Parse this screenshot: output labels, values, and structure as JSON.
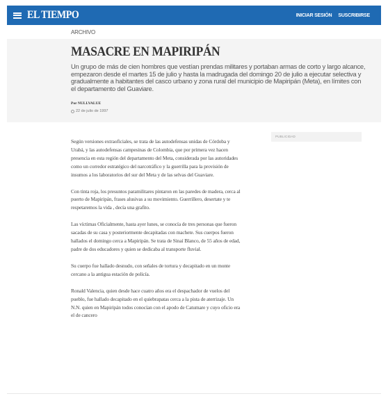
{
  "header": {
    "logo_text": "EL TIEMPO",
    "signin_label": "INICIAR SESIÓN",
    "subscribe_label": "SUSCRIBIRSE",
    "menu_icon": "hamburger-menu-icon",
    "brand_color": "#1f6ab3"
  },
  "section": {
    "label": "ARCHIVO"
  },
  "article": {
    "title": "MASACRE EN MAPIRIPÁN",
    "lead": "Un grupo de más de cien hombres que vestían prendas militares y portaban armas de corto y largo alcance, empezaron desde el martes 15 de julio y hasta la madrugada del domingo 20 de julio a ejecutar selectiva y gradualmente a habitantes del casco urbano y zona rural del municipio de Mapiripán (Meta), en límites con el departamento del Guaviare.",
    "byline": "Por NULLVALUE",
    "date": "22 de julio de 1997",
    "paragraphs": [
      "Según versiones extraoficiales, se trata de las autodefensas unidas de Córdoba y Urabá, y las autodefensas campesinas de Colombia, que por primera vez hacen presencia en esta región del departamento del Meta, considerada por las autoridades como un corredor estratégico del narcotráfico y la guerrilla para la provisión de insumos a los laboratorios del sur del Meta y de las selvas del Guaviare.",
      "Con tinta roja, los presuntos paramilitares pintaron en las paredes de madera, cerca al puerto de Mapiripán, frases alusivas a su movimiento. Guerrillero, desertate y te respetaremos la vida , decía una grafito.",
      "Las víctimas Oficialmente, hasta ayer lunes, se conocía de tres personas que fueron sacadas de su casa y posteriormente decapitadas con machete. Sus cuerpos fueron hallados el domingo cerca a Mapiripán. Se trata de Sinaí Blanco, de 55 años de edad, padre de dos educadores y quien se dedicaba al transporte fluvial.",
      "Su cuerpo fue hallado desnudo, con señales de tortura y decapitado en un monte cercano a la antigua estación de policía.",
      "Ronald Valencia, quien desde hace cuatro años era el despachador de vuelos del pueblo, fue hallado decapitado en el quiebrapatas cerca a la pista de aterrizaje. Un N.N. quien en Mapiripán todos conocían con el apodo de Catumare y cuyo oficio era el de cancero"
    ]
  },
  "sidebar": {
    "ad_label": "PUBLICIDAD"
  }
}
